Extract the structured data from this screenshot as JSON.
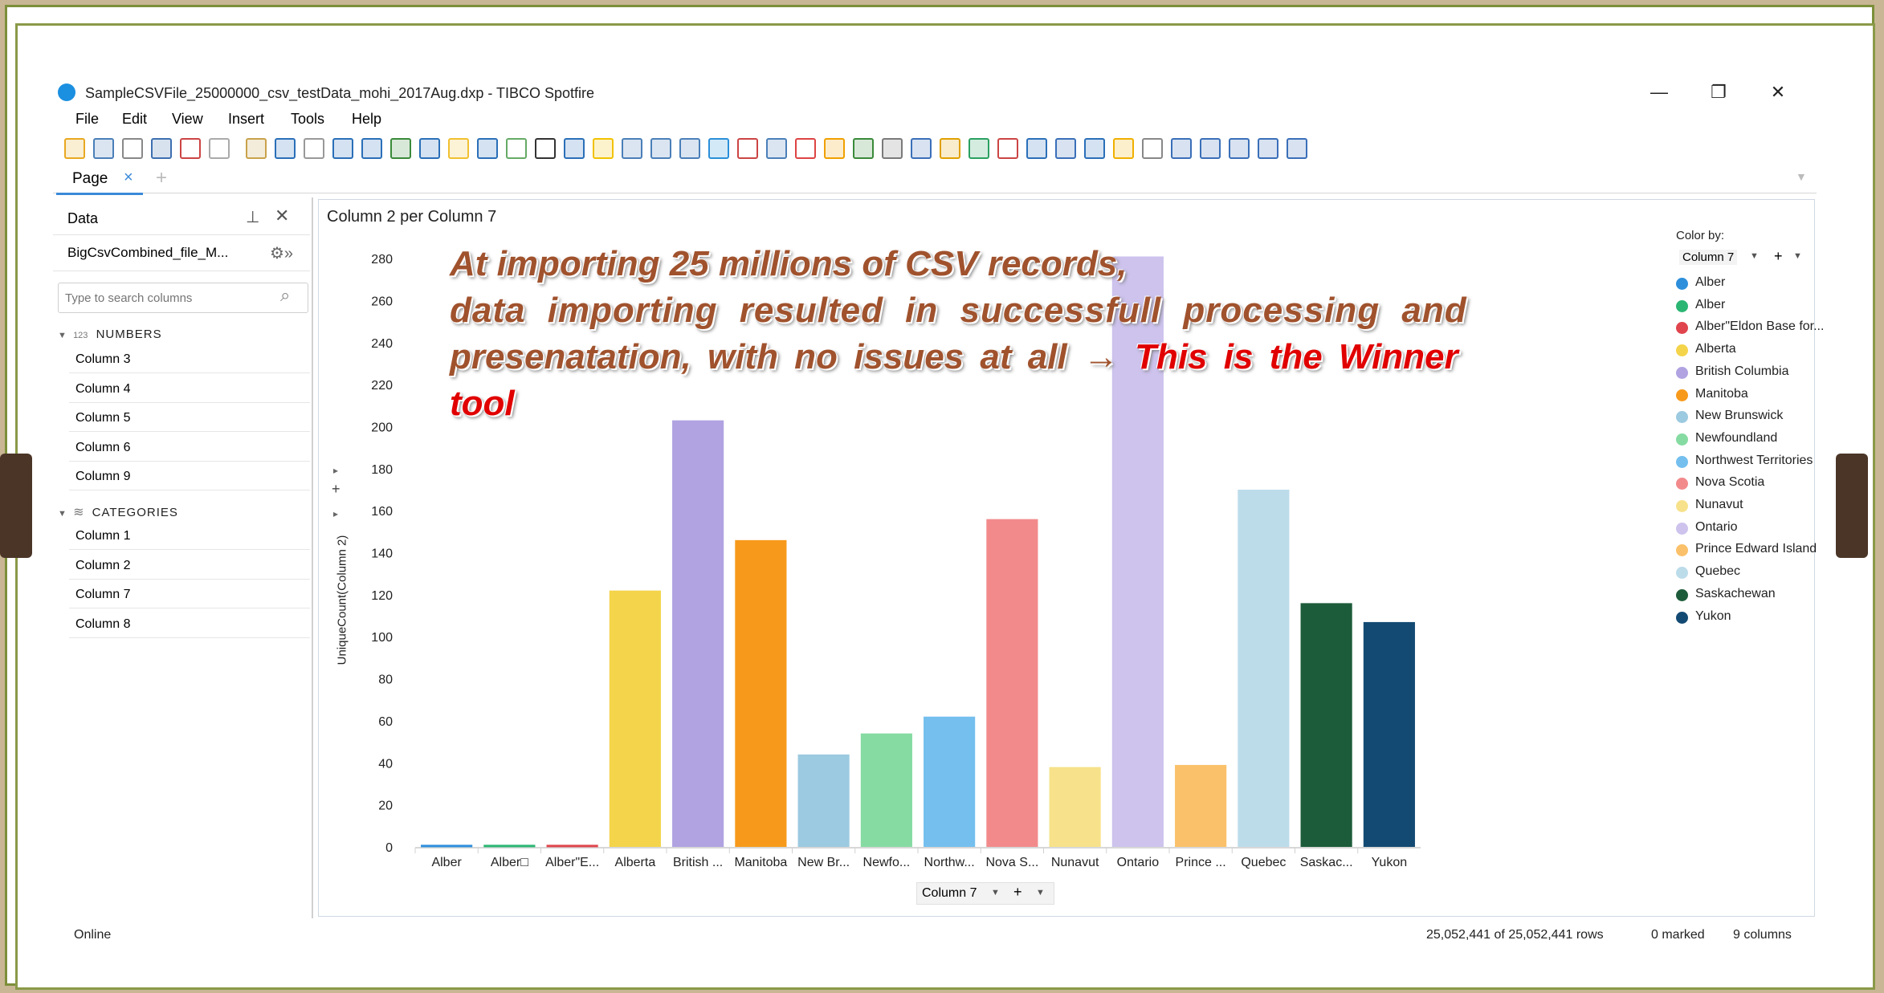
{
  "window": {
    "title": "SampleCSVFile_25000000_csv_testData_mohi_2017Aug.dxp - TIBCO Spotfire",
    "minimize": "—",
    "restore": "❐",
    "close": "✕"
  },
  "menu": [
    "File",
    "Edit",
    "View",
    "Insert",
    "Tools",
    "Help"
  ],
  "page_tab": {
    "label": "Page",
    "close": "×",
    "add": "+"
  },
  "sidebar": {
    "title": "Data",
    "pin": "📌",
    "close": "✕",
    "source": "BigCsvCombined_file_M...",
    "search_placeholder": "Type to search columns",
    "numbers_header": "NUMBERS",
    "numbers_prefix": "123",
    "numbers": [
      "Column 3",
      "Column 4",
      "Column 5",
      "Column 6",
      "Column 9"
    ],
    "categories_header": "CATEGORIES",
    "categories": [
      "Column 1",
      "Column 2",
      "Column 7",
      "Column 8"
    ]
  },
  "chart_panel": {
    "title": "Column 2 per Column 7",
    "x_selector": "Column 7",
    "color_by_label": "Color by:",
    "color_by_value": "Column 7",
    "plus": "+"
  },
  "overlay": {
    "line1": "At importing 25 millions of CSV records,",
    "line2": "data importing resulted in successfull processing and",
    "line3_a": "presenatation, with no issues at all → ",
    "line3_b": "This is the Winner",
    "line4": "tool"
  },
  "status": {
    "state": "Online",
    "rows": "25,052,441 of 25,052,441 rows",
    "marked": "0 marked",
    "columns": "9 columns"
  },
  "chart_data": {
    "type": "bar",
    "title": "Column 2 per Column 7",
    "xlabel": "Column 7",
    "ylabel": "UniqueCount(Column 2)",
    "ylim": [
      0,
      285
    ],
    "yticks": [
      0,
      20,
      40,
      60,
      80,
      100,
      120,
      140,
      160,
      180,
      200,
      220,
      240,
      260,
      280
    ],
    "categories": [
      "Alber",
      "Alber□",
      "Alber\"E...",
      "Alberta",
      "British ...",
      "Manitoba",
      "New Br...",
      "Newfo...",
      "Northw...",
      "Nova S...",
      "Nunavut",
      "Ontario",
      "Prince ...",
      "Quebec",
      "Saskac...",
      "Yukon"
    ],
    "values": [
      1,
      1,
      1,
      122,
      203,
      146,
      44,
      54,
      62,
      156,
      38,
      281,
      39,
      170,
      116,
      107
    ],
    "colors": [
      "#2d8fdb",
      "#2bb673",
      "#e0454d",
      "#f4d44a",
      "#b1a3e1",
      "#f79a1b",
      "#9ccae0",
      "#86dba2",
      "#74bfee",
      "#f28a8c",
      "#f7e28b",
      "#cdc3ed",
      "#fac16a",
      "#bcdcea",
      "#1d5c3a",
      "#134a73"
    ],
    "legend": {
      "placement": "right",
      "entries": [
        "Alber",
        "Alber",
        "Alber\"Eldon Base for...",
        "Alberta",
        "British Columbia",
        "Manitoba",
        "New Brunswick",
        "Newfoundland",
        "Northwest Territories",
        "Nova Scotia",
        "Nunavut",
        "Ontario",
        "Prince Edward Island",
        "Quebec",
        "Saskachewan",
        "Yukon"
      ]
    },
    "grid": false
  }
}
